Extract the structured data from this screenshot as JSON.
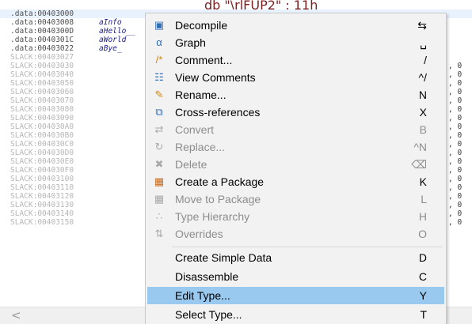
{
  "listing": {
    "instruction_fragment": "db  \"\\rlFUP2\"  ; 11h",
    "rows": [
      {
        "addr": ".data:00403000",
        "label": "",
        "tail": "",
        "kind": "data",
        "selected": true
      },
      {
        "addr": ".data:00403008",
        "label": "aInfo",
        "tail": "",
        "kind": "data",
        "selected": false
      },
      {
        "addr": ".data:0040300D",
        "label": "aHello__",
        "tail": "",
        "kind": "data",
        "selected": false
      },
      {
        "addr": ".data:0040301C",
        "label": "aWorld",
        "tail": "",
        "kind": "data",
        "selected": false
      },
      {
        "addr": ".data:00403022",
        "label": "aBye_",
        "tail": "",
        "kind": "data",
        "selected": false
      },
      {
        "addr": "SLACK:00403027",
        "label": "",
        "tail": "",
        "kind": "slack",
        "selected": false
      },
      {
        "addr": "SLACK:00403030",
        "label": "",
        "tail": ", 0",
        "kind": "slack",
        "selected": false
      },
      {
        "addr": "SLACK:00403040",
        "label": "",
        "tail": ", 0",
        "kind": "slack",
        "selected": false
      },
      {
        "addr": "SLACK:00403050",
        "label": "",
        "tail": ", 0",
        "kind": "slack",
        "selected": false
      },
      {
        "addr": "SLACK:00403060",
        "label": "",
        "tail": ", 0",
        "kind": "slack",
        "selected": false
      },
      {
        "addr": "SLACK:00403070",
        "label": "",
        "tail": ", 0",
        "kind": "slack",
        "selected": false
      },
      {
        "addr": "SLACK:00403080",
        "label": "",
        "tail": ", 0",
        "kind": "slack",
        "selected": false
      },
      {
        "addr": "SLACK:00403090",
        "label": "",
        "tail": ", 0",
        "kind": "slack",
        "selected": false
      },
      {
        "addr": "SLACK:004030A0",
        "label": "",
        "tail": ", 0",
        "kind": "slack",
        "selected": false
      },
      {
        "addr": "SLACK:004030B0",
        "label": "",
        "tail": ", 0",
        "kind": "slack",
        "selected": false
      },
      {
        "addr": "SLACK:004030C0",
        "label": "",
        "tail": ", 0",
        "kind": "slack",
        "selected": false
      },
      {
        "addr": "SLACK:004030D0",
        "label": "",
        "tail": ", 0",
        "kind": "slack",
        "selected": false
      },
      {
        "addr": "SLACK:004030E0",
        "label": "",
        "tail": ", 0",
        "kind": "slack",
        "selected": false
      },
      {
        "addr": "SLACK:004030F0",
        "label": "",
        "tail": ", 0",
        "kind": "slack",
        "selected": false
      },
      {
        "addr": "SLACK:00403100",
        "label": "",
        "tail": ", 0",
        "kind": "slack",
        "selected": false
      },
      {
        "addr": "SLACK:00403110",
        "label": "",
        "tail": ", 0",
        "kind": "slack",
        "selected": false
      },
      {
        "addr": "SLACK:00403120",
        "label": "",
        "tail": ", 0",
        "kind": "slack",
        "selected": false
      },
      {
        "addr": "SLACK:00403130",
        "label": "",
        "tail": ", 0",
        "kind": "slack",
        "selected": false
      },
      {
        "addr": "SLACK:00403140",
        "label": "",
        "tail": ", 0",
        "kind": "slack",
        "selected": false
      },
      {
        "addr": "SLACK:00403150",
        "label": "",
        "tail": ", 0",
        "kind": "slack",
        "selected": false
      }
    ]
  },
  "scrollbar": {
    "left_arrow": "<"
  },
  "context_menu": {
    "items": [
      {
        "label": "Decompile",
        "shortcut": "⇆",
        "icon": "decompile-icon",
        "glyph": "▣",
        "icon_color": "#2f6fb8",
        "enabled": true
      },
      {
        "label": "Graph",
        "shortcut": "␣",
        "icon": "graph-icon",
        "glyph": "α",
        "icon_color": "#2f6fb8",
        "enabled": true
      },
      {
        "label": "Comment...",
        "shortcut": "/",
        "icon": "comment-icon",
        "glyph": "/*",
        "icon_color": "#d08a10",
        "enabled": true
      },
      {
        "label": "View Comments",
        "shortcut": "^/",
        "icon": "view-comments-icon",
        "glyph": "☷",
        "icon_color": "#2f6fb8",
        "enabled": true
      },
      {
        "label": "Rename...",
        "shortcut": "N",
        "icon": "rename-icon",
        "glyph": "✎",
        "icon_color": "#d08a10",
        "enabled": true
      },
      {
        "label": "Cross-references",
        "shortcut": "X",
        "icon": "xrefs-icon",
        "glyph": "⧉",
        "icon_color": "#2f6fb8",
        "enabled": true
      },
      {
        "label": "Convert",
        "shortcut": "B",
        "icon": "convert-icon",
        "glyph": "⇄",
        "icon_color": "#a9a9a9",
        "enabled": false
      },
      {
        "label": "Replace...",
        "shortcut": "^N",
        "icon": "replace-icon",
        "glyph": "↻",
        "icon_color": "#a9a9a9",
        "enabled": false
      },
      {
        "label": "Delete",
        "shortcut": "⌫",
        "icon": "delete-icon",
        "glyph": "✖",
        "icon_color": "#a9a9a9",
        "enabled": false
      },
      {
        "label": "Create a Package",
        "shortcut": "K",
        "icon": "package-icon",
        "glyph": "▦",
        "icon_color": "#c86a1e",
        "enabled": true
      },
      {
        "label": "Move to Package",
        "shortcut": "L",
        "icon": "move-package-icon",
        "glyph": "▦",
        "icon_color": "#a9a9a9",
        "enabled": false
      },
      {
        "label": "Type Hierarchy",
        "shortcut": "H",
        "icon": "hierarchy-icon",
        "glyph": "∴",
        "icon_color": "#a9a9a9",
        "enabled": false
      },
      {
        "label": "Overrides",
        "shortcut": "O",
        "icon": "overrides-icon",
        "glyph": "⇅",
        "icon_color": "#a9a9a9",
        "enabled": false
      },
      {
        "label": "Create Simple Data",
        "shortcut": "D",
        "icon": "",
        "glyph": "",
        "icon_color": "#000000",
        "enabled": true
      },
      {
        "label": "Disassemble",
        "shortcut": "C",
        "icon": "",
        "glyph": "",
        "icon_color": "#000000",
        "enabled": true
      },
      {
        "label": "Edit Type...",
        "shortcut": "Y",
        "icon": "",
        "glyph": "",
        "icon_color": "#000000",
        "enabled": true,
        "highlighted": true
      },
      {
        "label": "Select Type...",
        "shortcut": "T",
        "icon": "",
        "glyph": "",
        "icon_color": "#000000",
        "enabled": true
      }
    ]
  },
  "colors": {
    "menu_background": "#f2f2f2",
    "menu_highlight": "#99c9ef",
    "disabled_text": "#8d8d8d",
    "label_text": "#1c1c88",
    "slack_address": "#b6b6b6"
  }
}
